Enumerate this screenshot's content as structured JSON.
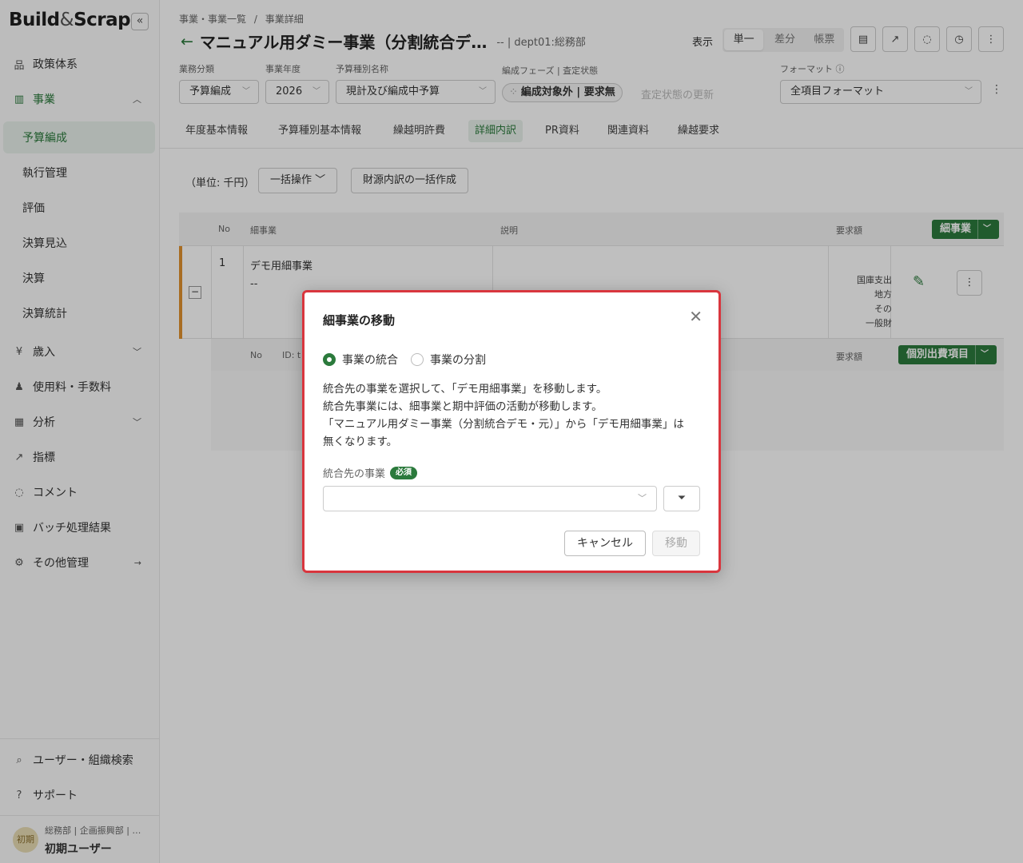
{
  "app": {
    "logo_main": "Build",
    "logo_amp": "&",
    "logo_end": "Scrap"
  },
  "sidebar": {
    "items": [
      {
        "label": "政策体系",
        "icon": "org-chart-icon"
      },
      {
        "label": "事業",
        "icon": "bar-chart-icon"
      },
      {
        "label": "歳入",
        "icon": "ledger-icon"
      },
      {
        "label": "使用料・手数料",
        "icon": "users-icon"
      },
      {
        "label": "分析",
        "icon": "table-icon"
      },
      {
        "label": "指標",
        "icon": "trend-icon"
      },
      {
        "label": "コメント",
        "icon": "comment-icon"
      },
      {
        "label": "バッチ処理結果",
        "icon": "terminal-icon"
      },
      {
        "label": "その他管理",
        "icon": "gear-icon"
      }
    ],
    "sub_items": [
      "予算編成",
      "執行管理",
      "評価",
      "決算見込",
      "決算",
      "決算統計"
    ],
    "bottom": [
      {
        "label": "ユーザー・組織検索",
        "icon": "search-icon"
      },
      {
        "label": "サポート",
        "icon": "help-icon"
      }
    ],
    "user": {
      "avatar": "初期",
      "org": "総務部 | 企画振興部 | …",
      "name": "初期ユーザー"
    }
  },
  "header": {
    "breadcrumb": [
      "事業・事業一覧",
      "/",
      "事業詳細"
    ],
    "title": "マニュアル用ダミー事業（分割統合デ…",
    "meta": "-- | dept01:総務部",
    "view_label": "表示",
    "view_modes": [
      "単一",
      "差分",
      "帳票"
    ],
    "filters": {
      "category_label": "業務分類",
      "category_value": "予算編成",
      "year_label": "事業年度",
      "year_value": "2026",
      "budget_label": "予算種別名称",
      "budget_value": "現計及び編成中予算",
      "phase_label": "編成フェーズ | 査定状態",
      "phase_value": "編成対象外 | 要求無",
      "phase_update": "査定状態の更新",
      "format_label": "フォーマット",
      "format_value": "全項目フォーマット"
    }
  },
  "tabs": [
    "年度基本情報",
    "予算種別基本情報",
    "繰越明許費",
    "詳細内訳",
    "PR資料",
    "関連資料",
    "繰越要求"
  ],
  "toolbar": {
    "unit": "（単位: 千円）",
    "bulk": "一括操作",
    "source": "財源内訳の一括作成"
  },
  "table": {
    "headers": [
      "No",
      "細事業",
      "説明",
      "要求額"
    ],
    "add_button": "細事業",
    "row": {
      "no": "1",
      "name": "デモ用細事業",
      "sub": "--",
      "amounts": [
        "国庫支出",
        "地方",
        "その",
        "一般財"
      ]
    },
    "sub_headers": [
      "No",
      "ID: t",
      "要求額"
    ],
    "sub_button": "個別出費項目"
  },
  "modal": {
    "title": "細事業の移動",
    "options": [
      "事業の統合",
      "事業の分割"
    ],
    "desc": [
      "統合先の事業を選択して、「デモ用細事業」を移動します。",
      "統合先事業には、細事業と期中評価の活動が移動します。",
      "「マニュアル用ダミー事業（分割統合デモ・元）」から「デモ用細事業」は",
      "無くなります。"
    ],
    "field_label": "統合先の事業",
    "required": "必須",
    "cancel": "キャンセル",
    "move": "移動"
  },
  "colors": {
    "accent": "#2b7a3c",
    "modal_border": "#d9363e",
    "row_marker": "#e0902e"
  }
}
